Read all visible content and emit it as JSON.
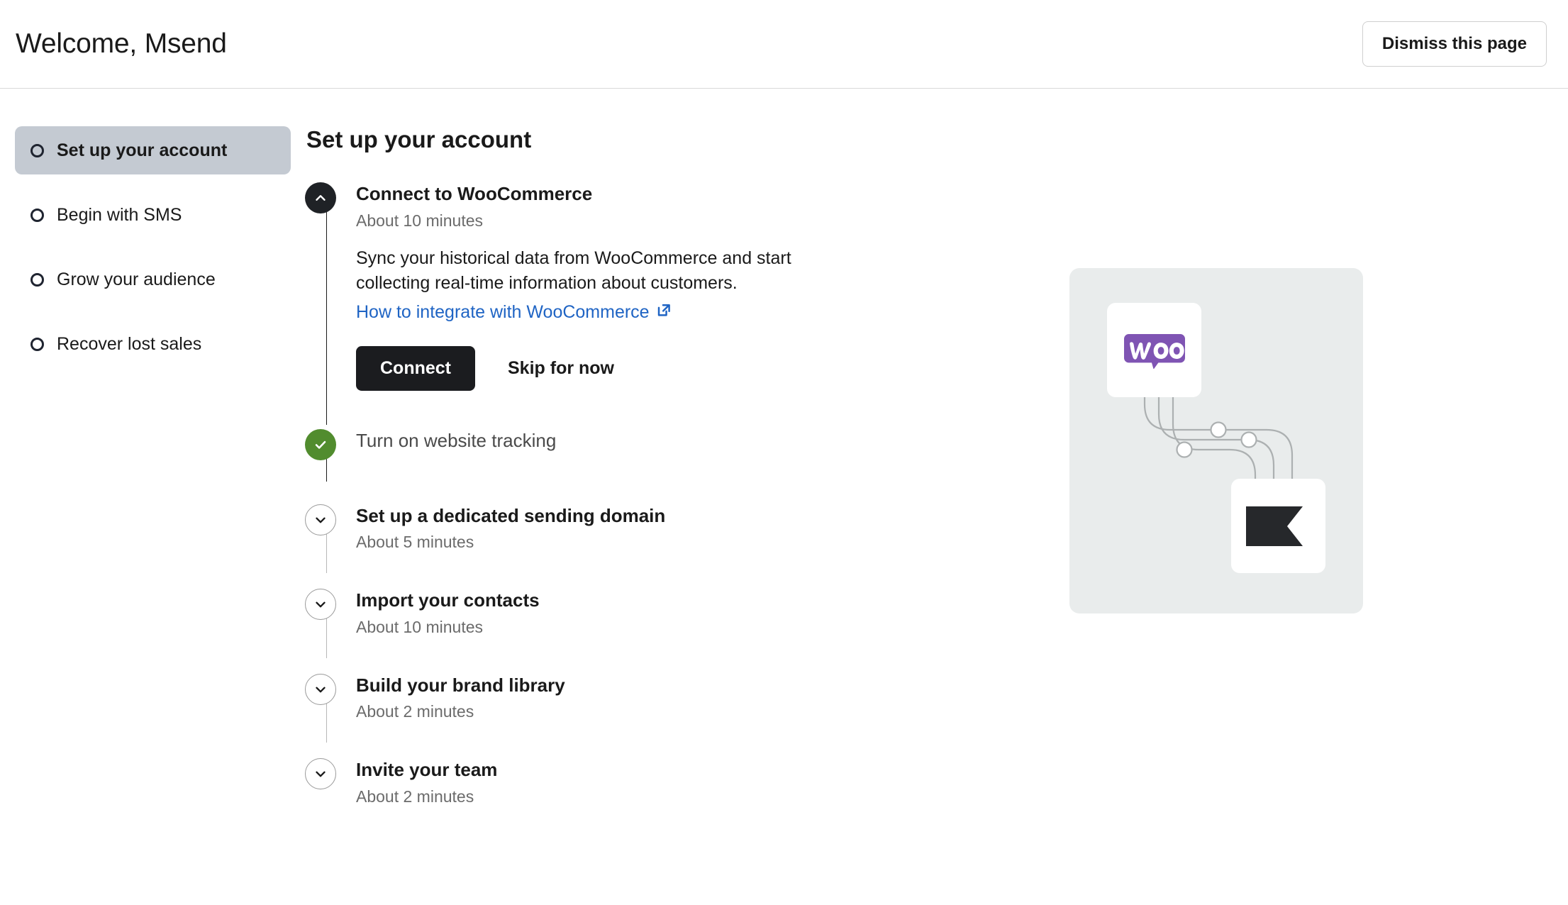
{
  "header": {
    "title": "Welcome, Msend",
    "dismiss_label": "Dismiss this page"
  },
  "sidebar": {
    "items": [
      {
        "label": "Set up your account",
        "active": true
      },
      {
        "label": "Begin with SMS",
        "active": false
      },
      {
        "label": "Grow your audience",
        "active": false
      },
      {
        "label": "Recover lost sales",
        "active": false
      }
    ]
  },
  "main": {
    "section_title": "Set up your account",
    "steps": [
      {
        "name": "Connect to WooCommerce",
        "time": "About 10 minutes",
        "state": "expanded",
        "description": "Sync your historical data from WooCommerce and start collecting real-time information about customers.",
        "link_label": "How to integrate with WooCommerce",
        "primary_label": "Connect",
        "secondary_label": "Skip for now"
      },
      {
        "name": "Turn on website tracking",
        "time": "",
        "state": "complete"
      },
      {
        "name": "Set up a dedicated sending domain",
        "time": "About 5 minutes",
        "state": "collapsed"
      },
      {
        "name": "Import your contacts",
        "time": "About 10 minutes",
        "state": "collapsed"
      },
      {
        "name": "Build your brand library",
        "time": "About 2 minutes",
        "state": "collapsed"
      },
      {
        "name": "Invite your team",
        "time": "About 2 minutes",
        "state": "collapsed"
      }
    ]
  },
  "illustration": {
    "source_logo": "woocommerce-logo",
    "target_logo": "klaviyo-flag-logo",
    "connector_nodes": 3
  },
  "colors": {
    "accent_link": "#1f64c4",
    "complete_green": "#518c2e",
    "primary_button": "#1b1c1f",
    "sidebar_active": "#c4cad2",
    "panel_bg": "#e9ecec",
    "woo_purple": "#7f54b3",
    "flag_dark": "#26282b"
  }
}
